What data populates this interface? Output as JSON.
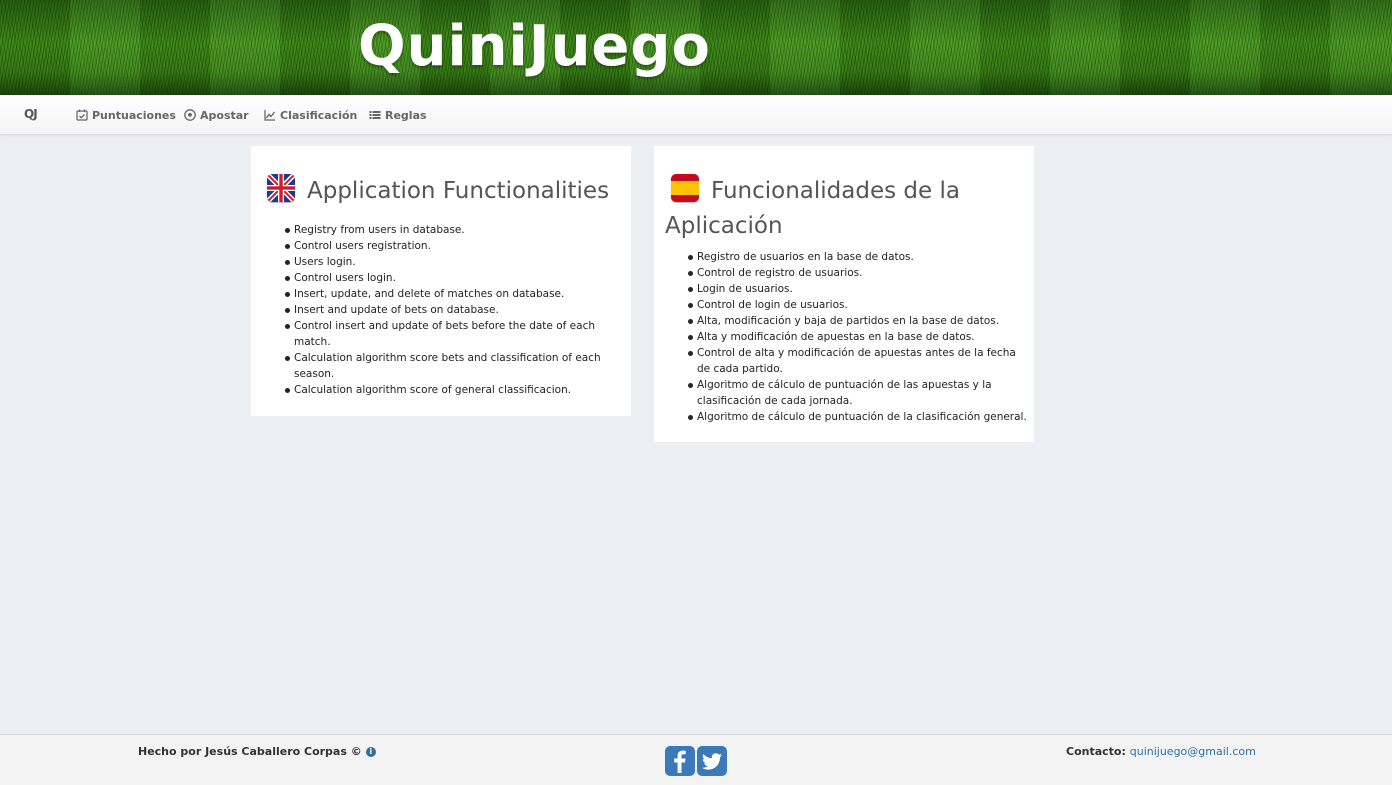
{
  "header": {
    "logo_text": "QuiniJuego"
  },
  "navbar": {
    "brand": "QJ",
    "items": [
      {
        "label": "Puntuaciones",
        "icon": "calendar-check-icon"
      },
      {
        "label": "Apostar",
        "icon": "soccer-ball-icon"
      },
      {
        "label": "Clasificación",
        "icon": "line-chart-icon"
      },
      {
        "label": "Reglas",
        "icon": "list-icon"
      }
    ]
  },
  "english": {
    "title": "Application Functionalities",
    "flag": "uk-flag-icon",
    "items": [
      "Registry from users in database.",
      "Control users registration.",
      "Users login.",
      "Control users login.",
      "Insert, update, and delete of matches on database.",
      "Insert and update of bets on database.",
      "Control insert and update of bets before the date of each match.",
      "Calculation algorithm score bets and classification of each season.",
      "Calculation algorithm score of general classificacion."
    ]
  },
  "spanish": {
    "title": "Funcionalidades de la Aplicación",
    "flag": "spain-flag-icon",
    "items": [
      "Registro de usuarios en la base de datos.",
      "Control de registro de usuarios.",
      "Login de usuarios.",
      "Control de login de usuarios.",
      "Alta, modificación y baja de partidos en la base de datos.",
      "Alta y modificación de apuestas en la base de datos.",
      "Control de alta y modificación de apuestas antes de la fecha de cada partido.",
      "Algoritmo de cálculo de puntuación de las apuestas y la clasificación de cada jornada.",
      "Algoritmo de cálculo de puntuación de la clasificación general."
    ]
  },
  "footer": {
    "credit": "Hecho por Jesús Caballero Corpas ©",
    "contact_label": "Contacto:",
    "contact_email": "quinijuego@gmail.com"
  },
  "colors": {
    "accent": "#2f6ea8",
    "social": "#3b79b8",
    "background": "#ecf0f3"
  }
}
